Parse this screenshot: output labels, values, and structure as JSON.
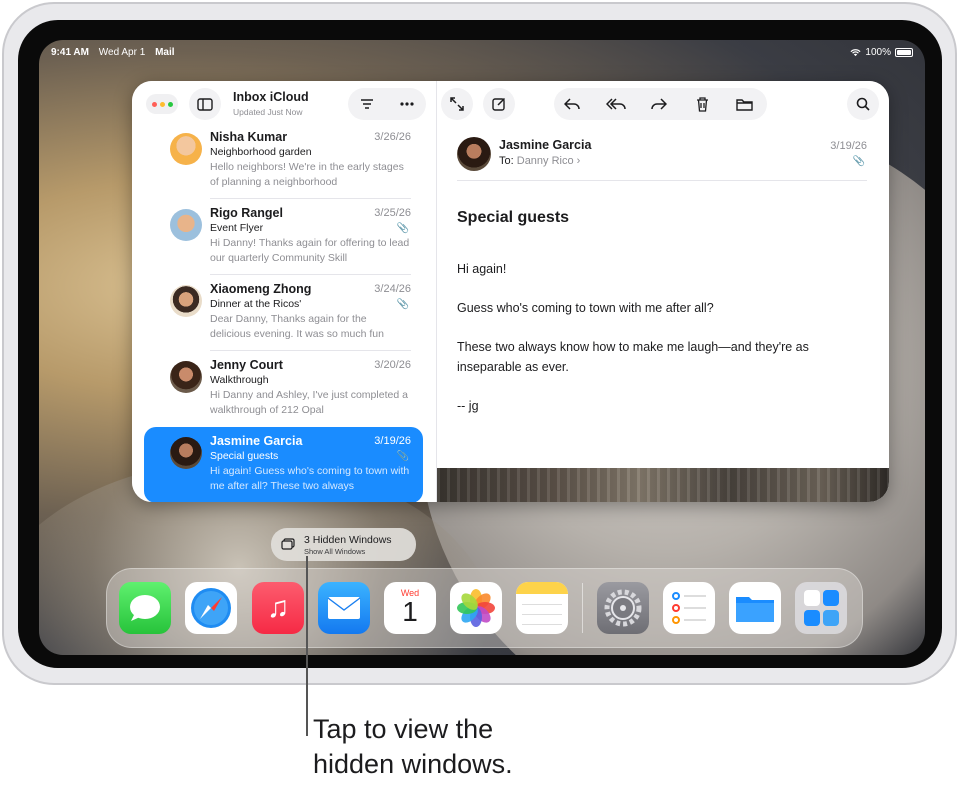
{
  "status_bar": {
    "time": "9:41 AM",
    "date": "Wed Apr 1",
    "app": "Mail",
    "battery": "100%"
  },
  "mail": {
    "mailbox_title": "Inbox iCloud",
    "mailbox_subtitle": "Updated Just Now",
    "messages": [
      {
        "sender": "Nisha Kumar",
        "date": "3/26/26",
        "subject": "Neighborhood garden",
        "preview": "Hello neighbors! We're in the early stages of planning a neighborhood",
        "attachment": false,
        "selected": false
      },
      {
        "sender": "Rigo Rangel",
        "date": "3/25/26",
        "subject": "Event Flyer",
        "preview": "Hi Danny! Thanks again for offering to lead our quarterly Community Skill",
        "attachment": true,
        "selected": false
      },
      {
        "sender": "Xiaomeng Zhong",
        "date": "3/24/26",
        "subject": "Dinner at the Ricos'",
        "preview": "Dear Danny, Thanks again for the delicious evening. It was so much fun",
        "attachment": true,
        "selected": false
      },
      {
        "sender": "Jenny Court",
        "date": "3/20/26",
        "subject": "Walkthrough",
        "preview": "Hi Danny and Ashley, I've just completed a walkthrough of 212 Opal",
        "attachment": false,
        "selected": false
      },
      {
        "sender": "Jasmine Garcia",
        "date": "3/19/26",
        "subject": "Special guests",
        "preview": "Hi again! Guess who's coming to town with me after all? These two always",
        "attachment": true,
        "selected": true
      }
    ],
    "reader": {
      "from": "Jasmine Garcia",
      "to_label": "To:",
      "to": "Danny Rico",
      "date": "3/19/26",
      "subject": "Special guests",
      "body": [
        "Hi again!",
        "Guess who's coming to town with me after all?",
        "These two always know how to make me laugh—and they're as inseparable as ever.",
        "-- jg"
      ]
    },
    "toolbar_icons": [
      "sidebar-toggle-icon",
      "filter-icon",
      "more-icon",
      "expand-icon",
      "compose-icon",
      "reply-icon",
      "reply-all-icon",
      "forward-icon",
      "trash-icon",
      "folder-icon",
      "search-icon"
    ]
  },
  "hidden_windows": {
    "title": "3 Hidden Windows",
    "subtitle": "Show All Windows"
  },
  "dock": {
    "calendar_day": "Wed",
    "calendar_date": "1",
    "apps": [
      "Messages",
      "Safari",
      "Music",
      "Mail",
      "Calendar",
      "Photos",
      "Notes",
      "Settings",
      "Reminders",
      "Files",
      "App Library"
    ]
  },
  "callout": {
    "line1": "Tap to view the",
    "line2": "hidden windows."
  },
  "colors": {
    "accent": "#1a8cff",
    "text": "#1c1c1e",
    "secondary": "#8e8e93"
  }
}
